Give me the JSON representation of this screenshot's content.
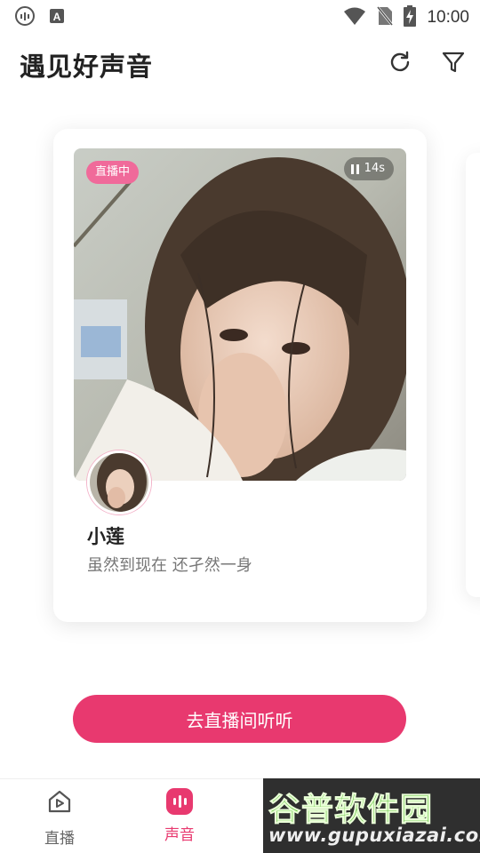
{
  "status_bar": {
    "time": "10:00",
    "icons": [
      "podcast-app-icon",
      "font-app-icon",
      "wifi-icon",
      "no-sim-icon",
      "battery-charging-icon"
    ]
  },
  "header": {
    "title": "遇见好声音",
    "refresh_icon": "refresh-icon",
    "filter_icon": "filter-icon"
  },
  "card": {
    "badge": "直播中",
    "duration": "14s",
    "name": "小莲",
    "bio": "虽然到现在 还孑然一身"
  },
  "cta": {
    "label": "去直播间听听"
  },
  "bottom_nav": {
    "items": [
      {
        "label": "直播",
        "icon": "home-play-icon",
        "active": false
      },
      {
        "label": "声音",
        "icon": "voice-icon",
        "active": true
      }
    ]
  },
  "watermark": {
    "brand": "谷普软件园",
    "url": "www.gupuxiazai.com"
  },
  "colors": {
    "accent": "#e8396f",
    "badge": "#f06a9a",
    "watermark_green": "#5fbf3a"
  }
}
